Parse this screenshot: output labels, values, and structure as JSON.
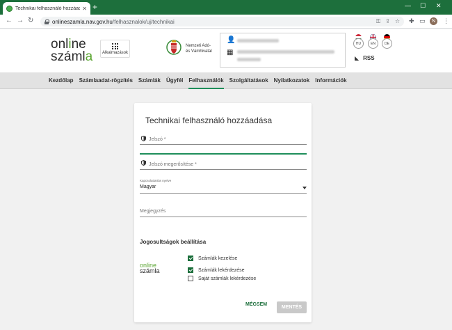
{
  "browser": {
    "tab_title": "Technikai felhasználó hozzáadása",
    "tab_close": "✕",
    "new_tab": "+",
    "url_host": "onlineszamla.nav.gov.hu",
    "url_path": "/felhasznalok/uj/technikai",
    "back": "←",
    "forward": "→",
    "reload": "↻",
    "minimize": "—",
    "maximize": "☐",
    "close": "✕",
    "profile_initial": "N"
  },
  "header": {
    "logo_line1_a": "onl",
    "logo_line1_b": "i",
    "logo_line1_c": "ne",
    "logo_line2_a": "száml",
    "logo_line2_b": "a",
    "apps_label": "Alkalmazások",
    "nav_line1": "Nemzeti Adó-",
    "nav_line2": "és Vámhivatal",
    "languages": [
      "HU",
      "EN",
      "DE"
    ],
    "rss_label": "RSS"
  },
  "mainnav": {
    "items": [
      "Kezdőlap",
      "Számlaadat-rögzítés",
      "Számlák",
      "Ügyfél",
      "Felhasználók",
      "Szolgáltatások",
      "Nyilatkozatok",
      "Információk"
    ],
    "active_index": 4
  },
  "form": {
    "title": "Technikai felhasználó hozzáadása",
    "password_label": "Jelszó *",
    "password_confirm_label": "Jelszó megerősítése *",
    "language_label": "Kapcsolattartás nyelve",
    "language_value": "Magyar",
    "note_label": "Megjegyzés",
    "permissions_title": "Jogosultságok beállítása",
    "mini_logo_line1": "online",
    "mini_logo_line2": "számla",
    "permissions": [
      {
        "label": "Számlák kezelése",
        "checked": true
      },
      {
        "label": "Számlák lekérdezése",
        "checked": true
      },
      {
        "label": "Saját számlák lekérdezése",
        "checked": false
      }
    ],
    "cancel_label": "MÉGSEM",
    "save_label": "MENTÉS"
  },
  "colors": {
    "brand_green": "#1d6f3c",
    "logo_green": "#5aa531",
    "active_underline": "#1e8e5a"
  }
}
